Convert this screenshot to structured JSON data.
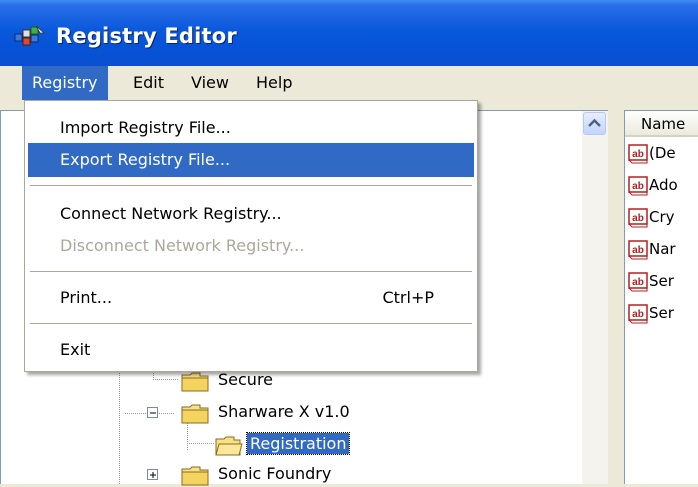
{
  "window": {
    "title": "Registry Editor",
    "icon": "registry-editor-icon"
  },
  "menubar": {
    "items": [
      "Registry",
      "Edit",
      "View",
      "Help"
    ],
    "active": "Registry"
  },
  "registry_menu": {
    "import": "Import Registry File...",
    "export": "Export Registry File...",
    "connect": "Connect Network Registry...",
    "disconnect": "Disconnect Network Registry...",
    "print": "Print...",
    "print_shortcut": "Ctrl+P",
    "exit": "Exit",
    "highlighted": "Export Registry File...",
    "disabled": [
      "Disconnect Network Registry..."
    ]
  },
  "tree": {
    "items": [
      {
        "label": "Secure"
      },
      {
        "label": "Sharware X v1.0",
        "expanded": true
      },
      {
        "label": "Registration",
        "selected": true
      },
      {
        "label": "Sonic Foundry",
        "expanded": false
      }
    ]
  },
  "list": {
    "column_name": "Name",
    "rows": [
      "(De",
      "Ado",
      "Cry",
      "Nar",
      "Ser",
      "Ser"
    ],
    "row_icon": "string-value-icon"
  },
  "colors": {
    "title_blue": "#0653d8",
    "selection": "#316ac5",
    "chrome": "#ece9d8"
  }
}
